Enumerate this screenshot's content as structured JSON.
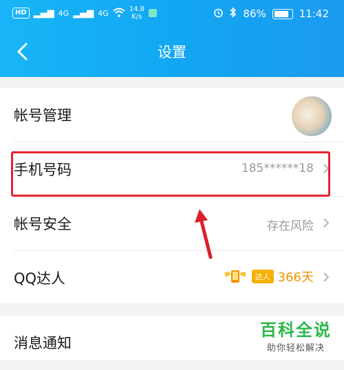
{
  "status_bar": {
    "hd": "HD",
    "net1": "4G",
    "net2": "4G",
    "speed_value": "14.8",
    "speed_unit": "K/s",
    "battery": "86%",
    "time": "11:42"
  },
  "header": {
    "title": "设置"
  },
  "rows": [
    {
      "label": "帐号管理"
    },
    {
      "label": "手机号码",
      "value": "185******18"
    },
    {
      "label": "帐号安全",
      "value": "存在风险"
    },
    {
      "label": "QQ达人",
      "badge": "达人",
      "value": "366天"
    }
  ],
  "notify": {
    "label": "消息通知"
  },
  "watermark": {
    "title": "百科全说",
    "subtitle": "助你轻松解决"
  },
  "colors": {
    "header": "#12a7f3",
    "highlight": "#e5232f",
    "arrow": "#d9202b",
    "badge": "#f5b100"
  }
}
